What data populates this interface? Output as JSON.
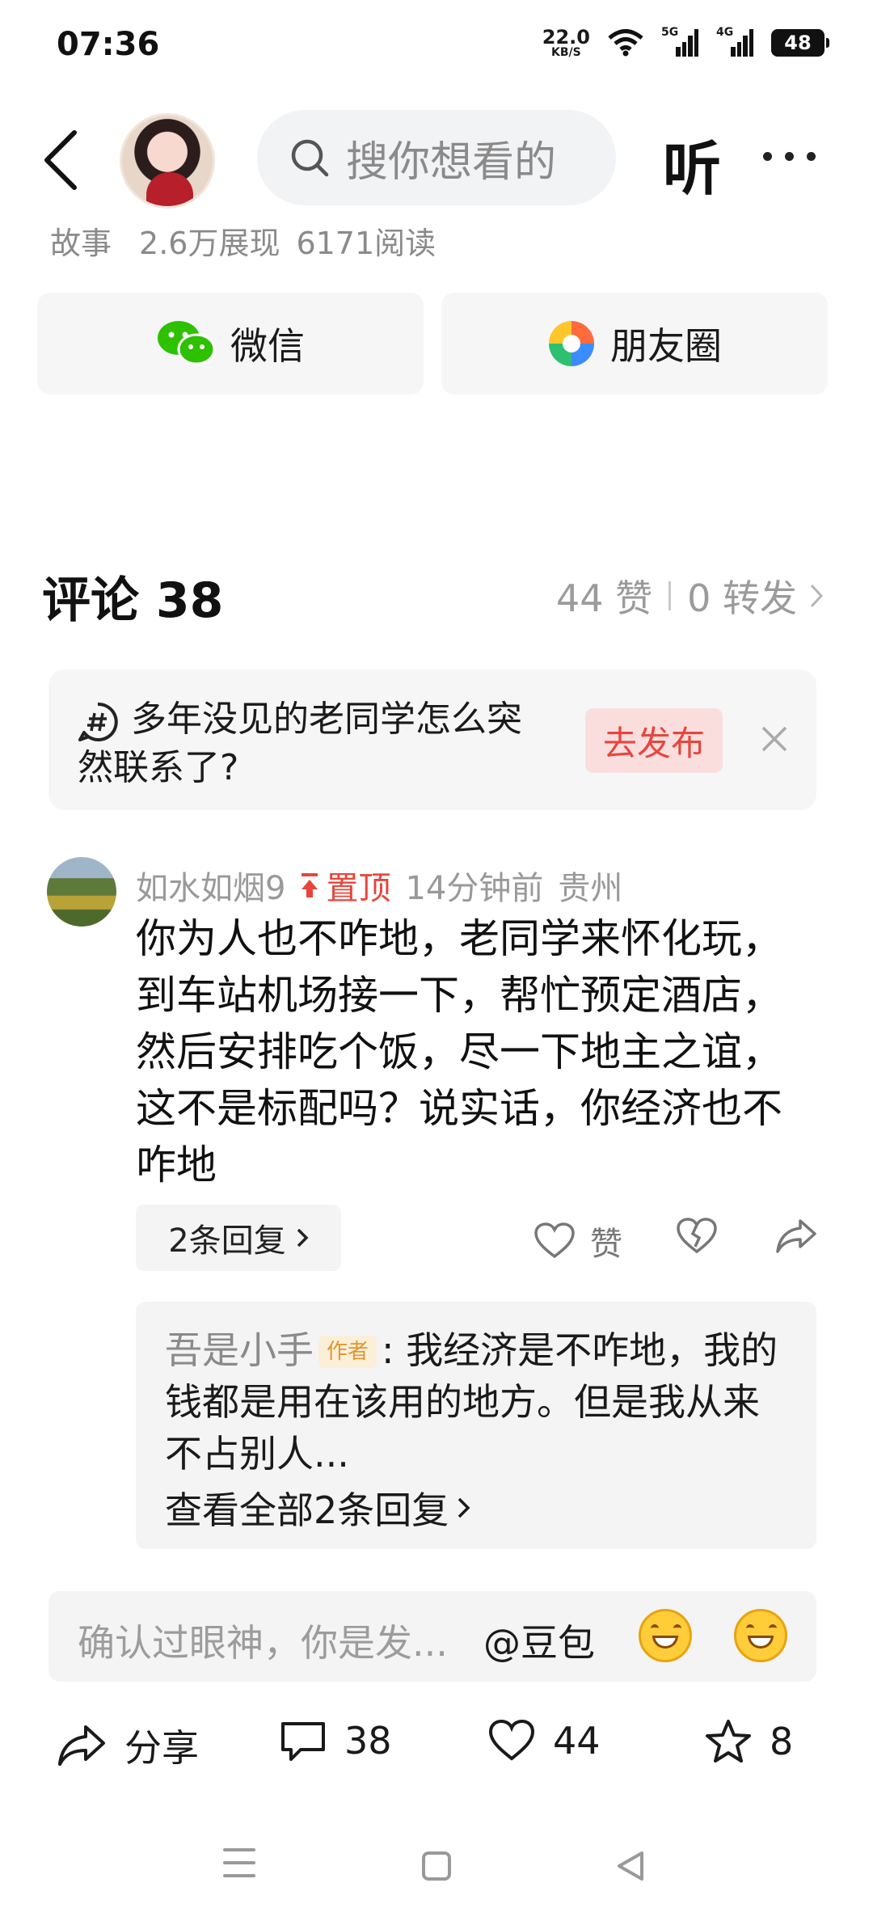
{
  "status_bar": {
    "time": "07:36",
    "net_speed": "22.0",
    "net_unit": "KB/S",
    "sim1": "5G",
    "sim2": "4G",
    "battery": "48"
  },
  "header": {
    "search_placeholder": "搜你想看的",
    "listen_label": "听",
    "avatar_icon": "user-avatar",
    "back_icon": "chevron-left-icon",
    "more_icon": "more-horizontal-icon"
  },
  "article_meta": {
    "category": "故事",
    "impressions": "2.6万展现",
    "reads": "6171阅读"
  },
  "share": {
    "wechat_label": "微信",
    "moments_label": "朋友圈"
  },
  "comments_header": {
    "title": "评论 38",
    "likes": "44 赞",
    "reposts": "0 转发"
  },
  "topic": {
    "line1": "多年没见的老同学怎么突",
    "line2": "然联系了?",
    "button": "去发布"
  },
  "comment": {
    "user": "如水如烟9",
    "pinned": "置顶",
    "time": "14分钟前",
    "location": "贵州",
    "body": "你为人也不咋地，老同学来怀化玩，到车站机场接一下，帮忙预定酒店，然后安排吃个饭，尽一下地主之谊，这不是标配吗？说实话，你经济也不咋地",
    "reply_count": "2条回复",
    "like_label": "赞",
    "reply": {
      "user": "吾是小手",
      "tag": "作者",
      "text": ": 我经济是不咋地，我的钱都是用在该用的地方。但是我从来不占别人...",
      "view_all": "查看全部2条回复"
    }
  },
  "input": {
    "placeholder": "确认过眼神，你是发...",
    "mention": "@豆包"
  },
  "bottom_bar": {
    "share": "分享",
    "comments": "38",
    "likes": "44",
    "favorites": "8"
  },
  "colors": {
    "accent_red": "#e8453c",
    "wechat_green": "#2dc100",
    "muted_gray": "#8a8a8a"
  }
}
